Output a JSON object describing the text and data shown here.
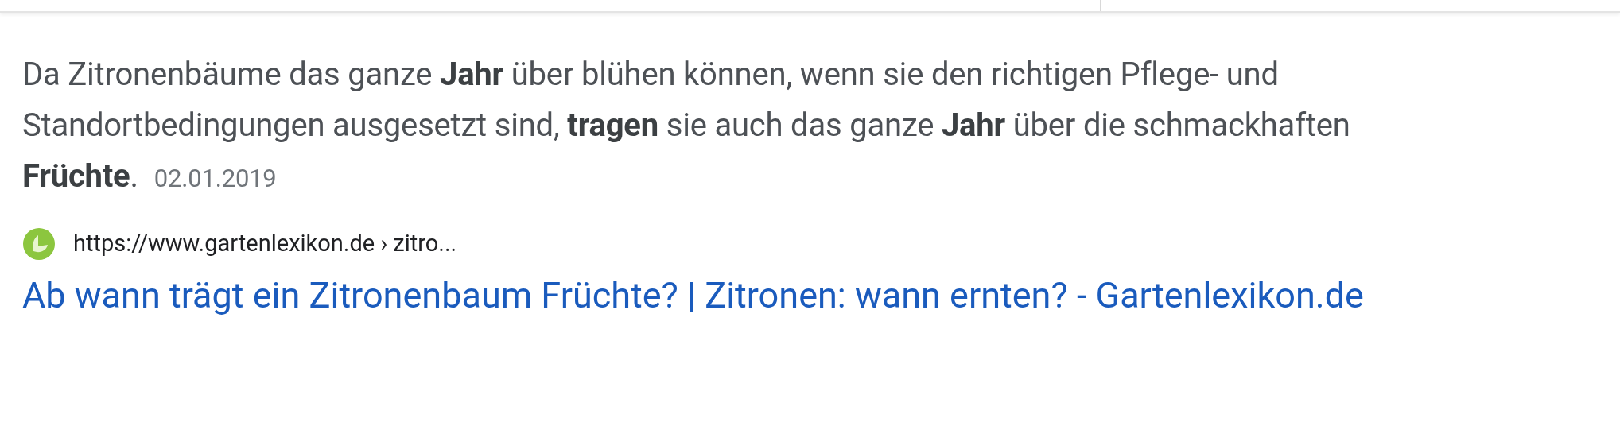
{
  "snippet": {
    "text": "Da Zitronenbäume das ganze **Jahr** über blühen können, wenn sie den richtigen Pflege- und Standortbedingungen ausgesetzt sind, **tragen** sie auch das ganze **Jahr** über die schmackhaften **Früchte**.",
    "date": "02.01.2019"
  },
  "result": {
    "url": "https://www.gartenlexikon.de › zitro...",
    "title": "Ab wann trägt ein Zitronenbaum Früchte? | Zitronen: wann ernten? - Gartenlexikon.de"
  }
}
